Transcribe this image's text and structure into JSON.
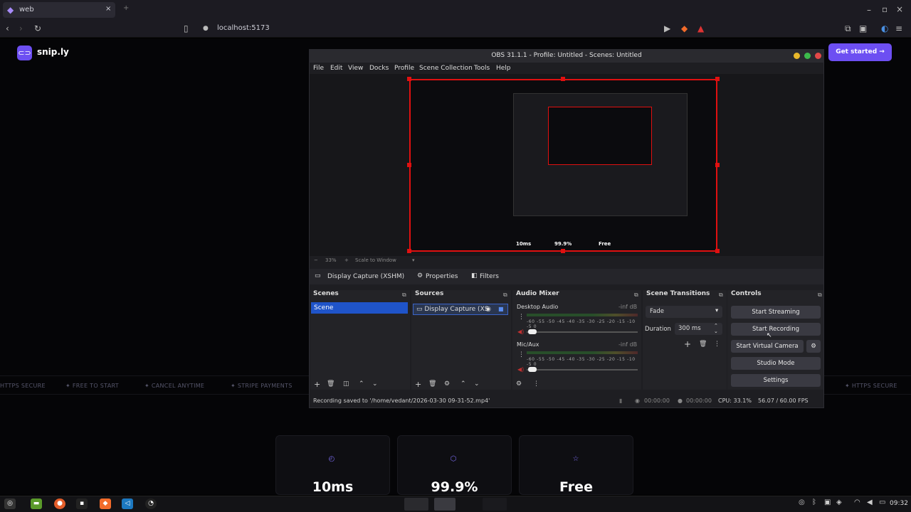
{
  "browser": {
    "tab_title": "web",
    "url": "localhost:5173",
    "new_tab": "+",
    "close_tab": "×"
  },
  "site": {
    "logo_text": "snip.ly",
    "cta_label": "Get started →",
    "ticker": [
      "HTTPS SECURE",
      "FREE TO START",
      "CANCEL ANYTIME",
      "STRIPE PAYMENTS",
      "HTTPS SECURE"
    ],
    "stats": [
      {
        "value": "10ms",
        "icon": "clock-icon"
      },
      {
        "value": "99.9%",
        "icon": "shield-icon"
      },
      {
        "value": "Free",
        "icon": "star-icon"
      }
    ]
  },
  "obs": {
    "title": "OBS 31.1.1 - Profile: Untitled - Scenes: Untitled",
    "menu": [
      "File",
      "Edit",
      "View",
      "Docks",
      "Profile",
      "Scene Collection",
      "Tools",
      "Help"
    ],
    "zoom": "33%",
    "scale_label": "Scale to Window",
    "selected_source": "Display Capture (XSHM)",
    "properties_label": "Properties",
    "filters_label": "Filters",
    "preview_stats": [
      "10ms",
      "99.9%",
      "Free"
    ],
    "scenes": {
      "title": "Scenes",
      "items": [
        "Scene"
      ]
    },
    "sources": {
      "title": "Sources",
      "items": [
        "Display Capture (XS"
      ]
    },
    "mixer": {
      "title": "Audio Mixer",
      "channels": [
        {
          "name": "Desktop Audio",
          "level": "-inf dB"
        },
        {
          "name": "Mic/Aux",
          "level": "-inf dB"
        }
      ],
      "scale": "-60 -55 -50 -45 -40 -35 -30 -25 -20 -15 -10 -5 0"
    },
    "transitions": {
      "title": "Scene Transitions",
      "type": "Fade",
      "duration_label": "Duration",
      "duration": "300 ms"
    },
    "controls": {
      "title": "Controls",
      "buttons": [
        "Start Streaming",
        "Start Recording",
        "Start Virtual Camera",
        "Studio Mode",
        "Settings"
      ]
    },
    "status": {
      "message": "Recording saved to '/home/vedant/2026-03-30 09-31-52.mp4'",
      "stream_time": "00:00:00",
      "rec_time": "00:00:00",
      "cpu": "CPU: 33.1%",
      "fps": "56.07 / 60.00 FPS"
    }
  },
  "taskbar": {
    "clock": "09:32"
  },
  "colors": {
    "accent": "#6d4ff2",
    "selection": "#1f54c9",
    "obs_bg": "#1e1e22",
    "preview_border": "#e01010"
  }
}
